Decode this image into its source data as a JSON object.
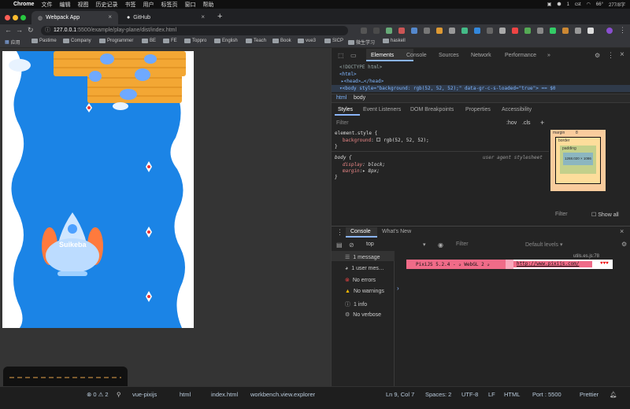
{
  "menubar": {
    "app": "Chrome",
    "items": [
      "文件",
      "编辑",
      "视图",
      "历史记录",
      "书签",
      "用户",
      "标签页",
      "窗口",
      "帮助"
    ],
    "right": [
      "1",
      "cst",
      "66°",
      "277/8字"
    ]
  },
  "tabs": [
    {
      "title": "Webpack App",
      "active": true
    },
    {
      "title": "GitHub",
      "active": false
    }
  ],
  "address": {
    "host": "127.0.0.1",
    "path": ":5500/example/play-plane/dist/index.html"
  },
  "bookmarks": [
    "应用",
    "Pastime",
    "Company",
    "Programmer",
    "BE",
    "FE",
    "Toppro",
    "English",
    "Teach",
    "Book",
    "vue3",
    "SICP",
    "微生学习",
    "haskell"
  ],
  "devtools": {
    "tabs": [
      "Elements",
      "Console",
      "Sources",
      "Network",
      "Performance"
    ],
    "more": "»",
    "dom": {
      "doctype": "<!DOCTYPE html>",
      "html": "<html>",
      "head": "▸<head>…</head>",
      "body": "▾<body style=\"background: rgb(52, 52, 52);\" data-gr-c-s-loaded=\"true\"> == $0"
    },
    "crumbs": [
      "html",
      "body"
    ],
    "subtabs": [
      "Styles",
      "Event Listeners",
      "DOM Breakpoints",
      "Properties",
      "Accessibility"
    ],
    "filter": "Filter",
    "hov": ":hov",
    "cls": ".cls",
    "plus": "+",
    "rule1": {
      "selector": "element.style {",
      "prop": "background",
      "value": "rgb(52, 52, 52);",
      "close": "}"
    },
    "rule2": {
      "selector": "body {",
      "source": "user agent stylesheet",
      "p1": "display",
      "v1": "block;",
      "p2": "margin",
      "v2": "8px;",
      "close": "}"
    },
    "boxmodel": {
      "margin": "margin",
      "border": "border",
      "padding": "padding",
      "content": "1268.020 × 1086",
      "dash": "-",
      "eight": "8"
    },
    "filter2": "Filter",
    "showall": "Show all"
  },
  "console": {
    "tabs": [
      "Console",
      "What's New"
    ],
    "context": "top",
    "filter": "Filter",
    "levels": "Default levels ▾",
    "sidebar": [
      {
        "label": "1 message",
        "icon": "list-icon"
      },
      {
        "label": "1 user mes…",
        "icon": "user-icon"
      },
      {
        "label": "No errors",
        "icon": "error-icon"
      },
      {
        "label": "No warnings",
        "icon": "warning-icon"
      },
      {
        "label": "1 info",
        "icon": "info-icon"
      },
      {
        "label": "No verbose",
        "icon": "verbose-icon"
      }
    ],
    "source": "utils.es.js:78",
    "pixi_msg": "PixiJS 5.2.4 - ✰ WebGL 2 ✰",
    "pixi_url": "http://www.pixijs.com/",
    "hearts": "♥♥♥",
    "prompt": "›"
  },
  "game": {
    "logo": "Suikeba"
  },
  "status": {
    "problems": "⊗ 0 ⚠ 2",
    "branch": "vue-pixijs",
    "lang1": "html",
    "file": "index.html",
    "workbench": "workbench.view.explorer",
    "pos": "Ln 9, Col 7",
    "spaces": "Spaces: 2",
    "enc": "UTF-8",
    "eol": "LF",
    "lang": "HTML",
    "port": "Port : 5500",
    "prettier": "Prettier"
  },
  "colors": {
    "accent": "#8ab4f8",
    "game_bg": "#1b84e6",
    "pixi": "#f06b88"
  }
}
